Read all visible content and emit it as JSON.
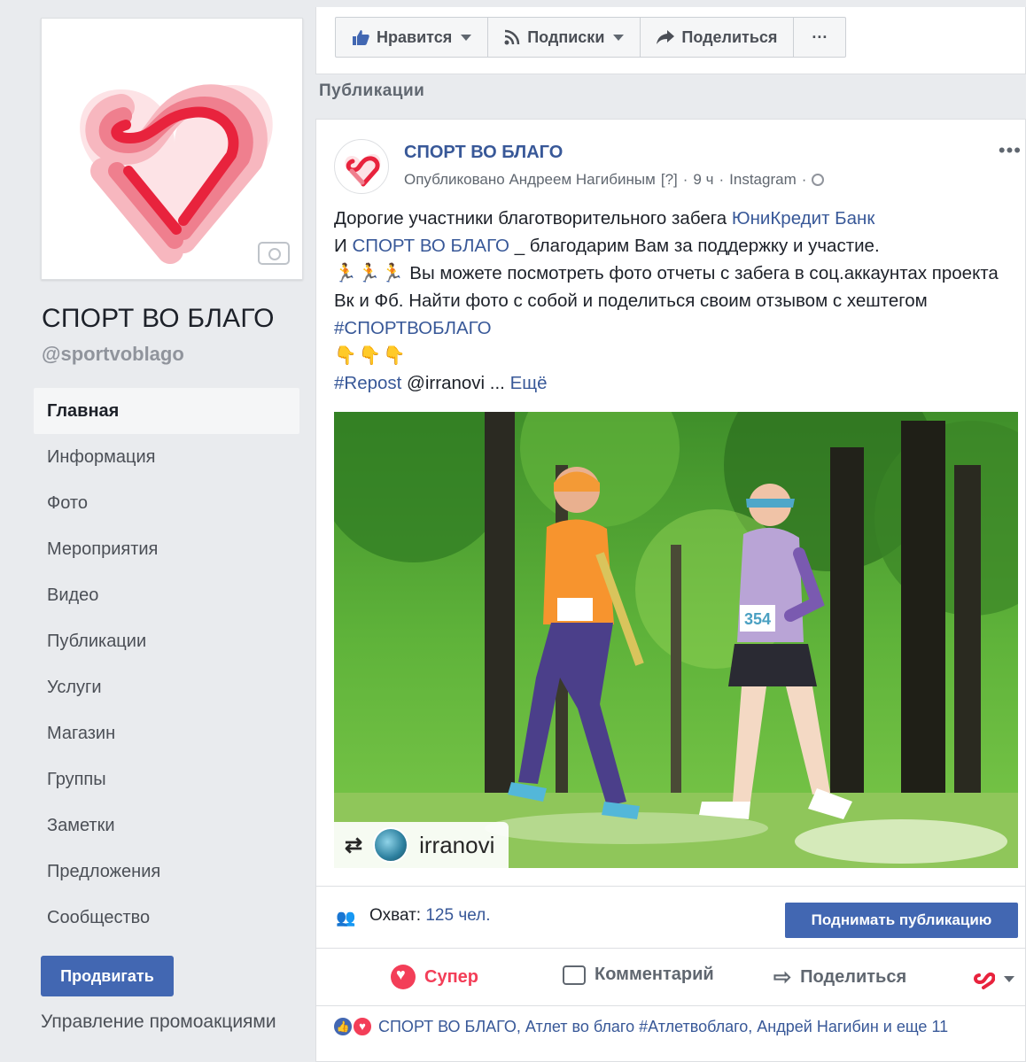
{
  "page": {
    "name": "СПОРТ ВО БЛАГО",
    "handle": "@sportvoblago"
  },
  "colors": {
    "brand_blue": "#4267b2",
    "link_blue": "#385898",
    "love_red": "#f33e58",
    "logo_red": "#e8233d"
  },
  "sidebar": {
    "items": [
      {
        "label": "Главная",
        "active": true
      },
      {
        "label": "Информация"
      },
      {
        "label": "Фото"
      },
      {
        "label": "Мероприятия"
      },
      {
        "label": "Видео"
      },
      {
        "label": "Публикации"
      },
      {
        "label": "Услуги"
      },
      {
        "label": "Магазин"
      },
      {
        "label": "Группы"
      },
      {
        "label": "Заметки"
      },
      {
        "label": "Предложения"
      },
      {
        "label": "Сообщество"
      }
    ],
    "promote_label": "Продвигать",
    "promo_manage_label": "Управление промоакциями"
  },
  "action_bar": {
    "like_label": "Нравится",
    "follow_label": "Подписки",
    "share_label": "Поделиться",
    "more_label": "···"
  },
  "section_title": "Публикации",
  "post": {
    "author": "СПОРТ ВО БЛАГО",
    "meta_by": "Опубликовано Андреем Нагибиным",
    "meta_help": "[?]",
    "meta_time": "9 ч",
    "meta_source": "Instagram",
    "more": "•••",
    "text": {
      "line1_pre": "Дорогие участники благотворительного забега ",
      "line1_link": "ЮниКредит Банк",
      "line2_pre": "И ",
      "line2_link": "СПОРТ ВО БЛАГО",
      "line2_post": " _ благодарим Вам за поддержку и участие.",
      "line3_emoji": "🏃🏃🏃",
      "line3_text": " Вы можете посмотреть фото отчеты с забега в соц.аккаунтах проекта Вк и Фб. Найти фото с собой и поделиться своим отзывом с хештегом ",
      "hashtag": "#СПОРТВОБЛАГО",
      "hands": "👇👇👇",
      "repost_tag": "#Repost",
      "repost_user": " @irranovi ",
      "ellipsis": "... ",
      "more_link": "Ещё"
    },
    "photo": {
      "repost_user": "irranovi",
      "bib_number": "354"
    },
    "reach_label": "Охват: ",
    "reach_value": "125 чел.",
    "boost_label": "Поднимать публикацию",
    "reactions": {
      "super_label": "Супер",
      "comment_label": "Комментарий",
      "share_label": "Поделиться"
    },
    "reactors_text": "СПОРТ ВО БЛАГО, Атлет во благо #Атлетвоблаго, Андрей Нагибин и еще 11"
  }
}
